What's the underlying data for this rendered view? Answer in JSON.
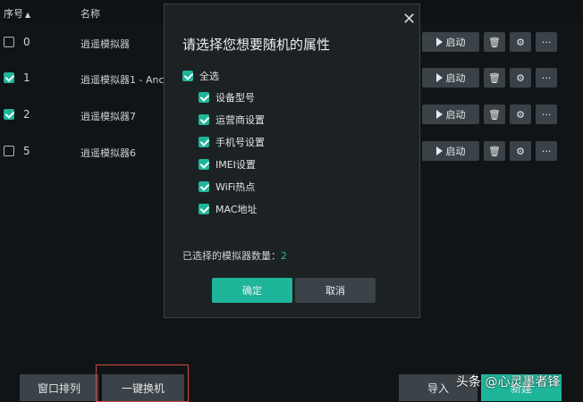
{
  "header": {
    "col_index": "序号",
    "col_name": "名称",
    "sort_icon": "caret-up"
  },
  "rows": [
    {
      "index": "0",
      "name": "逍遥模拟器",
      "checked": false
    },
    {
      "index": "1",
      "name": "逍遥模拟器1 - Anc",
      "checked": true
    },
    {
      "index": "2",
      "name": "逍遥模拟器7",
      "checked": true
    },
    {
      "index": "5",
      "name": "逍遥模拟器6",
      "checked": false
    }
  ],
  "row_actions": {
    "start_label": "启动",
    "delete_icon": "trash-icon",
    "settings_icon": "gear-icon",
    "more_label": "···"
  },
  "modal": {
    "title": "请选择您想要随机的属性",
    "close": "✕",
    "select_all": "全选",
    "options": [
      "设备型号",
      "运营商设置",
      "手机号设置",
      "IMEI设置",
      "WiFi热点",
      "MAC地址"
    ],
    "count_label": "已选择的模拟器数量：",
    "count_value": "2",
    "confirm": "确定",
    "cancel": "取消"
  },
  "bottom": {
    "arrange": "窗口排列",
    "one_key": "一键换机",
    "import": "导入",
    "new": "新建"
  },
  "watermark": "头条 @心灵墨者锋",
  "colors": {
    "accent": "#1fb59a",
    "highlight_border": "#d24a4a"
  }
}
